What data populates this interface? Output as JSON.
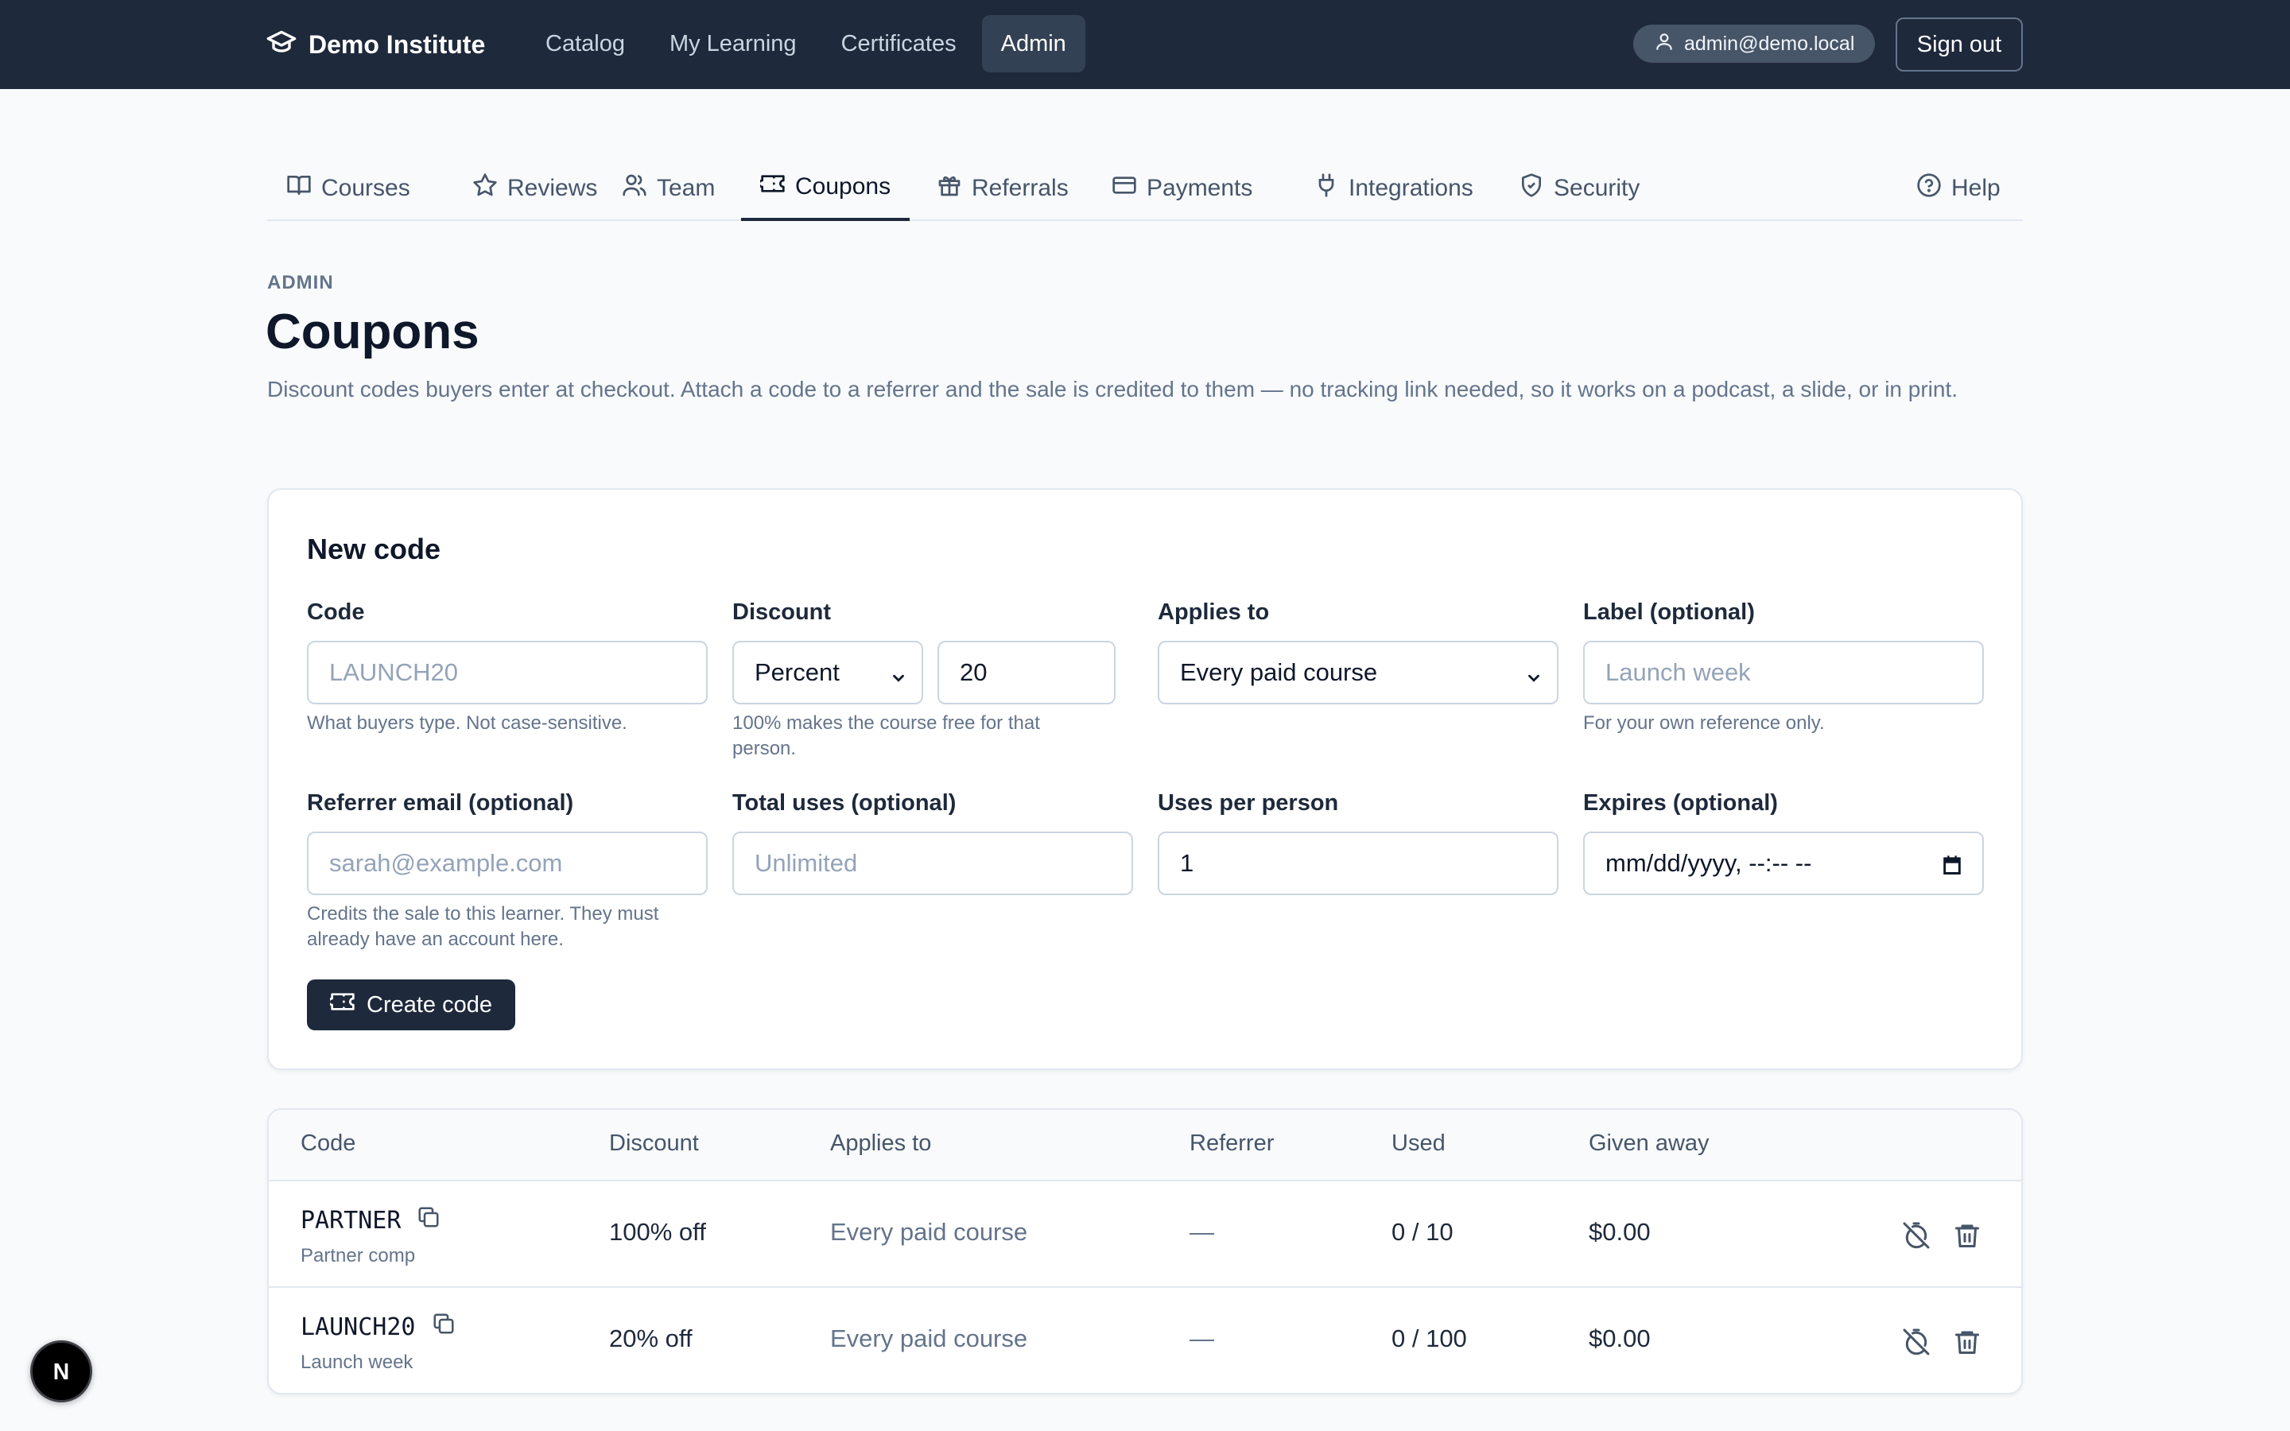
{
  "header": {
    "brand": "Demo Institute",
    "nav": [
      "Catalog",
      "My Learning",
      "Certificates",
      "Admin"
    ],
    "active_nav": "Admin",
    "user_email": "admin@demo.local",
    "signout_label": "Sign out"
  },
  "tabs": {
    "items": [
      "Courses",
      "Reviews",
      "Team",
      "Coupons",
      "Referrals",
      "Payments",
      "Integrations",
      "Security"
    ],
    "active": "Coupons",
    "help_label": "Help"
  },
  "page": {
    "eyebrow": "ADMIN",
    "title": "Coupons",
    "description": "Discount codes buyers enter at checkout. Attach a code to a referrer and the sale is credited to them — no tracking link needed, so it works on a podcast, a slide, or in print."
  },
  "form": {
    "title": "New code",
    "code": {
      "label": "Code",
      "placeholder": "LAUNCH20",
      "help": "What buyers type. Not case-sensitive."
    },
    "discount": {
      "label": "Discount",
      "type_value": "Percent",
      "amount_value": "20",
      "help": "100% makes the course free for that person."
    },
    "applies_to": {
      "label": "Applies to",
      "value": "Every paid course"
    },
    "label_field": {
      "label": "Label (optional)",
      "placeholder": "Launch week",
      "help": "For your own reference only."
    },
    "referrer": {
      "label": "Referrer email (optional)",
      "placeholder": "sarah@example.com",
      "help": "Credits the sale to this learner. They must already have an account here."
    },
    "total_uses": {
      "label": "Total uses (optional)",
      "placeholder": "Unlimited"
    },
    "uses_per_person": {
      "label": "Uses per person",
      "value": "1"
    },
    "expires": {
      "label": "Expires (optional)",
      "placeholder": "mm/dd/yyyy, --:-- --"
    },
    "submit_label": "Create code"
  },
  "table": {
    "columns": [
      "Code",
      "Discount",
      "Applies to",
      "Referrer",
      "Used",
      "Given away"
    ],
    "rows": [
      {
        "code": "PARTNER",
        "label": "Partner comp",
        "discount": "100% off",
        "applies_to": "Every paid course",
        "referrer": "—",
        "used": "0 / 10",
        "given_away": "$0.00"
      },
      {
        "code": "LAUNCH20",
        "label": "Launch week",
        "discount": "20% off",
        "applies_to": "Every paid course",
        "referrer": "—",
        "used": "0 / 100",
        "given_away": "$0.00"
      }
    ]
  },
  "badge": {
    "letter": "N"
  },
  "icons": {
    "brand": "graduation-cap-icon",
    "user": "user-icon",
    "tabs": [
      "book-icon",
      "star-icon",
      "users-icon",
      "ticket-icon",
      "gift-icon",
      "credit-card-icon",
      "plug-icon",
      "shield-icon"
    ],
    "help": "help-circle-icon",
    "copy": "copy-icon",
    "disable": "timer-off-icon",
    "delete": "trash-icon"
  },
  "colors": {
    "navbar": "#1e293b",
    "primary": "#1e293b",
    "muted": "#64748b",
    "border": "#e2e8f0"
  }
}
